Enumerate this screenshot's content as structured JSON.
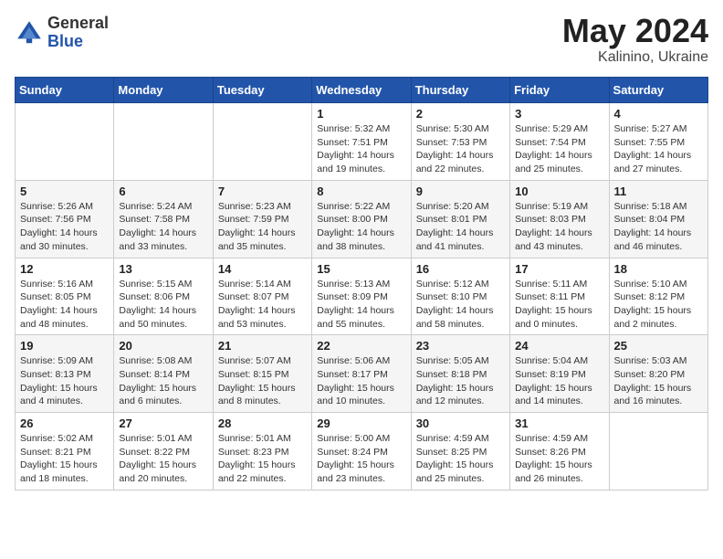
{
  "header": {
    "logo": {
      "general": "General",
      "blue": "Blue"
    },
    "title": "May 2024",
    "location": "Kalinino, Ukraine"
  },
  "weekdays": [
    "Sunday",
    "Monday",
    "Tuesday",
    "Wednesday",
    "Thursday",
    "Friday",
    "Saturday"
  ],
  "weeks": [
    [
      {
        "day": "",
        "info": ""
      },
      {
        "day": "",
        "info": ""
      },
      {
        "day": "",
        "info": ""
      },
      {
        "day": "1",
        "info": "Sunrise: 5:32 AM\nSunset: 7:51 PM\nDaylight: 14 hours\nand 19 minutes."
      },
      {
        "day": "2",
        "info": "Sunrise: 5:30 AM\nSunset: 7:53 PM\nDaylight: 14 hours\nand 22 minutes."
      },
      {
        "day": "3",
        "info": "Sunrise: 5:29 AM\nSunset: 7:54 PM\nDaylight: 14 hours\nand 25 minutes."
      },
      {
        "day": "4",
        "info": "Sunrise: 5:27 AM\nSunset: 7:55 PM\nDaylight: 14 hours\nand 27 minutes."
      }
    ],
    [
      {
        "day": "5",
        "info": "Sunrise: 5:26 AM\nSunset: 7:56 PM\nDaylight: 14 hours\nand 30 minutes."
      },
      {
        "day": "6",
        "info": "Sunrise: 5:24 AM\nSunset: 7:58 PM\nDaylight: 14 hours\nand 33 minutes."
      },
      {
        "day": "7",
        "info": "Sunrise: 5:23 AM\nSunset: 7:59 PM\nDaylight: 14 hours\nand 35 minutes."
      },
      {
        "day": "8",
        "info": "Sunrise: 5:22 AM\nSunset: 8:00 PM\nDaylight: 14 hours\nand 38 minutes."
      },
      {
        "day": "9",
        "info": "Sunrise: 5:20 AM\nSunset: 8:01 PM\nDaylight: 14 hours\nand 41 minutes."
      },
      {
        "day": "10",
        "info": "Sunrise: 5:19 AM\nSunset: 8:03 PM\nDaylight: 14 hours\nand 43 minutes."
      },
      {
        "day": "11",
        "info": "Sunrise: 5:18 AM\nSunset: 8:04 PM\nDaylight: 14 hours\nand 46 minutes."
      }
    ],
    [
      {
        "day": "12",
        "info": "Sunrise: 5:16 AM\nSunset: 8:05 PM\nDaylight: 14 hours\nand 48 minutes."
      },
      {
        "day": "13",
        "info": "Sunrise: 5:15 AM\nSunset: 8:06 PM\nDaylight: 14 hours\nand 50 minutes."
      },
      {
        "day": "14",
        "info": "Sunrise: 5:14 AM\nSunset: 8:07 PM\nDaylight: 14 hours\nand 53 minutes."
      },
      {
        "day": "15",
        "info": "Sunrise: 5:13 AM\nSunset: 8:09 PM\nDaylight: 14 hours\nand 55 minutes."
      },
      {
        "day": "16",
        "info": "Sunrise: 5:12 AM\nSunset: 8:10 PM\nDaylight: 14 hours\nand 58 minutes."
      },
      {
        "day": "17",
        "info": "Sunrise: 5:11 AM\nSunset: 8:11 PM\nDaylight: 15 hours\nand 0 minutes."
      },
      {
        "day": "18",
        "info": "Sunrise: 5:10 AM\nSunset: 8:12 PM\nDaylight: 15 hours\nand 2 minutes."
      }
    ],
    [
      {
        "day": "19",
        "info": "Sunrise: 5:09 AM\nSunset: 8:13 PM\nDaylight: 15 hours\nand 4 minutes."
      },
      {
        "day": "20",
        "info": "Sunrise: 5:08 AM\nSunset: 8:14 PM\nDaylight: 15 hours\nand 6 minutes."
      },
      {
        "day": "21",
        "info": "Sunrise: 5:07 AM\nSunset: 8:15 PM\nDaylight: 15 hours\nand 8 minutes."
      },
      {
        "day": "22",
        "info": "Sunrise: 5:06 AM\nSunset: 8:17 PM\nDaylight: 15 hours\nand 10 minutes."
      },
      {
        "day": "23",
        "info": "Sunrise: 5:05 AM\nSunset: 8:18 PM\nDaylight: 15 hours\nand 12 minutes."
      },
      {
        "day": "24",
        "info": "Sunrise: 5:04 AM\nSunset: 8:19 PM\nDaylight: 15 hours\nand 14 minutes."
      },
      {
        "day": "25",
        "info": "Sunrise: 5:03 AM\nSunset: 8:20 PM\nDaylight: 15 hours\nand 16 minutes."
      }
    ],
    [
      {
        "day": "26",
        "info": "Sunrise: 5:02 AM\nSunset: 8:21 PM\nDaylight: 15 hours\nand 18 minutes."
      },
      {
        "day": "27",
        "info": "Sunrise: 5:01 AM\nSunset: 8:22 PM\nDaylight: 15 hours\nand 20 minutes."
      },
      {
        "day": "28",
        "info": "Sunrise: 5:01 AM\nSunset: 8:23 PM\nDaylight: 15 hours\nand 22 minutes."
      },
      {
        "day": "29",
        "info": "Sunrise: 5:00 AM\nSunset: 8:24 PM\nDaylight: 15 hours\nand 23 minutes."
      },
      {
        "day": "30",
        "info": "Sunrise: 4:59 AM\nSunset: 8:25 PM\nDaylight: 15 hours\nand 25 minutes."
      },
      {
        "day": "31",
        "info": "Sunrise: 4:59 AM\nSunset: 8:26 PM\nDaylight: 15 hours\nand 26 minutes."
      },
      {
        "day": "",
        "info": ""
      }
    ]
  ]
}
